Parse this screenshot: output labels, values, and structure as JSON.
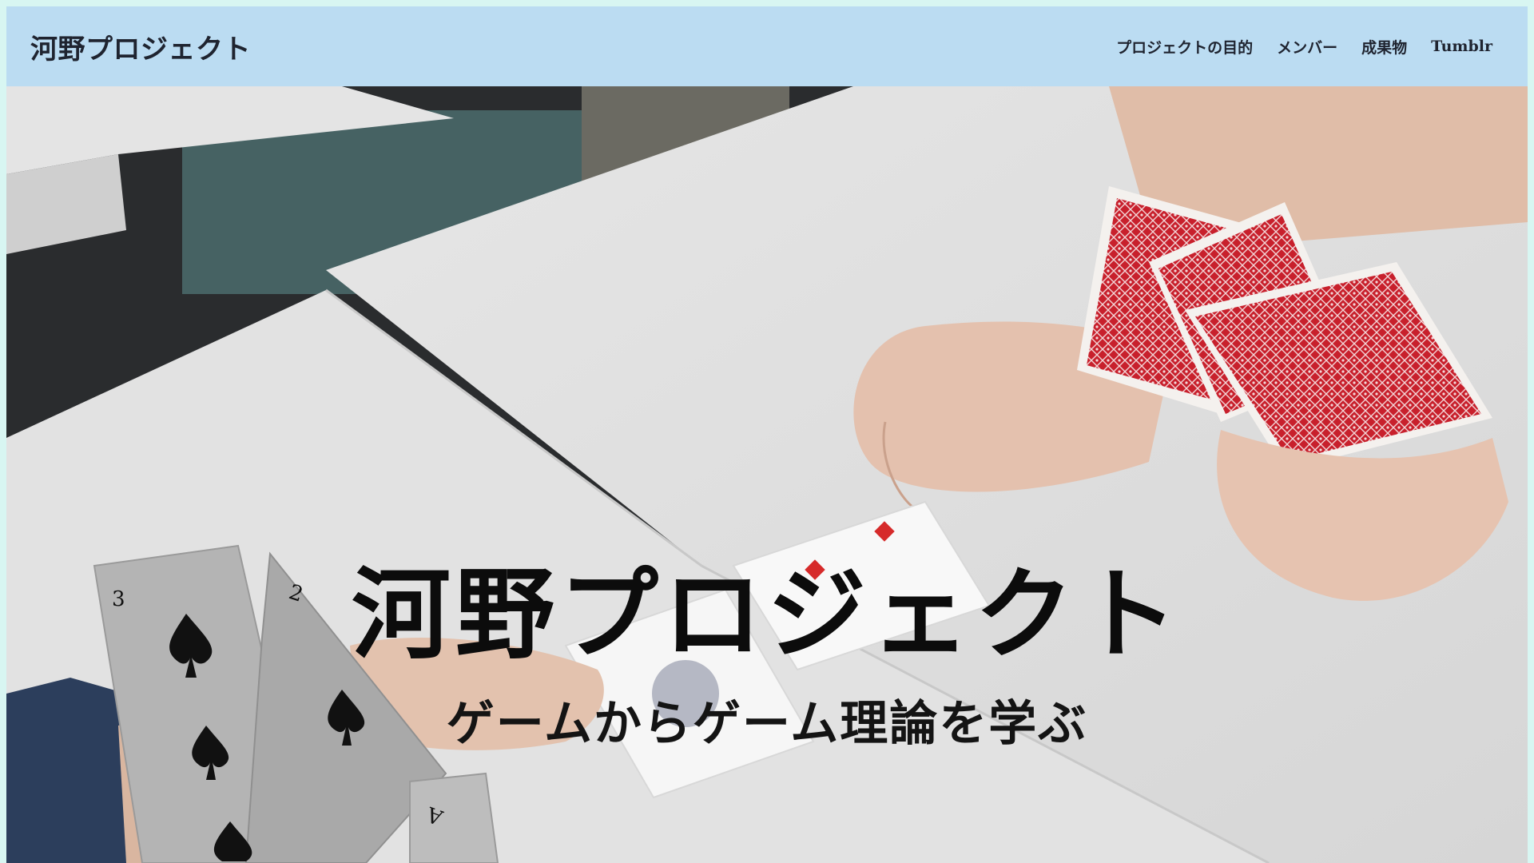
{
  "header": {
    "site_title": "河野プロジェクト",
    "nav": [
      {
        "label": "プロジェクトの目的"
      },
      {
        "label": "メンバー"
      },
      {
        "label": "成果物"
      },
      {
        "label": "Tumblr"
      }
    ]
  },
  "hero": {
    "title": "河野プロジェクト",
    "subtitle": "ゲームからゲーム理論を学ぶ",
    "colors": {
      "header_background": "#bbdcf2",
      "text": "#0c0c0c",
      "card_red": "#c8202c"
    }
  }
}
